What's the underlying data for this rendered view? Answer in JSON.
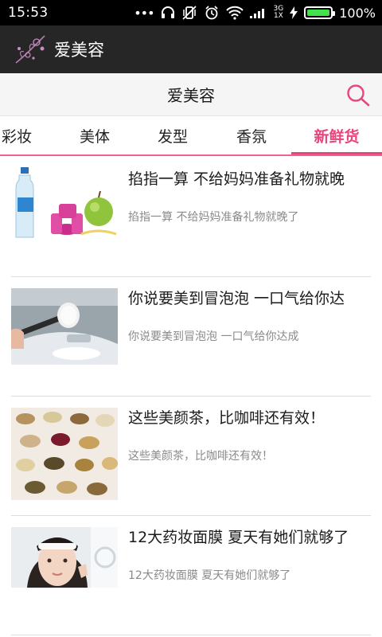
{
  "status_bar": {
    "time": "15:53",
    "network_label": "3G",
    "network_sublabel": "1X",
    "battery_percent_text": "100%",
    "battery_level": 1.0
  },
  "app_bar": {
    "title": "爱美容"
  },
  "sub_header": {
    "title": "爱美容"
  },
  "tabs": [
    {
      "label": "彩妆",
      "active": false
    },
    {
      "label": "美体",
      "active": false
    },
    {
      "label": "发型",
      "active": false
    },
    {
      "label": "香氛",
      "active": false
    },
    {
      "label": "新鲜货",
      "active": true
    }
  ],
  "articles": [
    {
      "title": "掐指一算 不给妈妈准备礼物就晚",
      "summary": "掐指一算 不给妈妈准备礼物就晚了"
    },
    {
      "title": "你说要美到冒泡泡 一口气给你达",
      "summary": "你说要美到冒泡泡 一口气给你达成"
    },
    {
      "title": "这些美颜茶，比咖啡还有效！",
      "summary": "这些美颜茶，比咖啡还有效！"
    },
    {
      "title": "12大药妆面膜 夏天有她们就够了",
      "summary": "12大药妆面膜 夏天有她们就够了"
    }
  ],
  "colors": {
    "accent": "#e8457d",
    "app_bar": "#262626",
    "status_bar": "#000000",
    "battery": "#3fe24a"
  }
}
